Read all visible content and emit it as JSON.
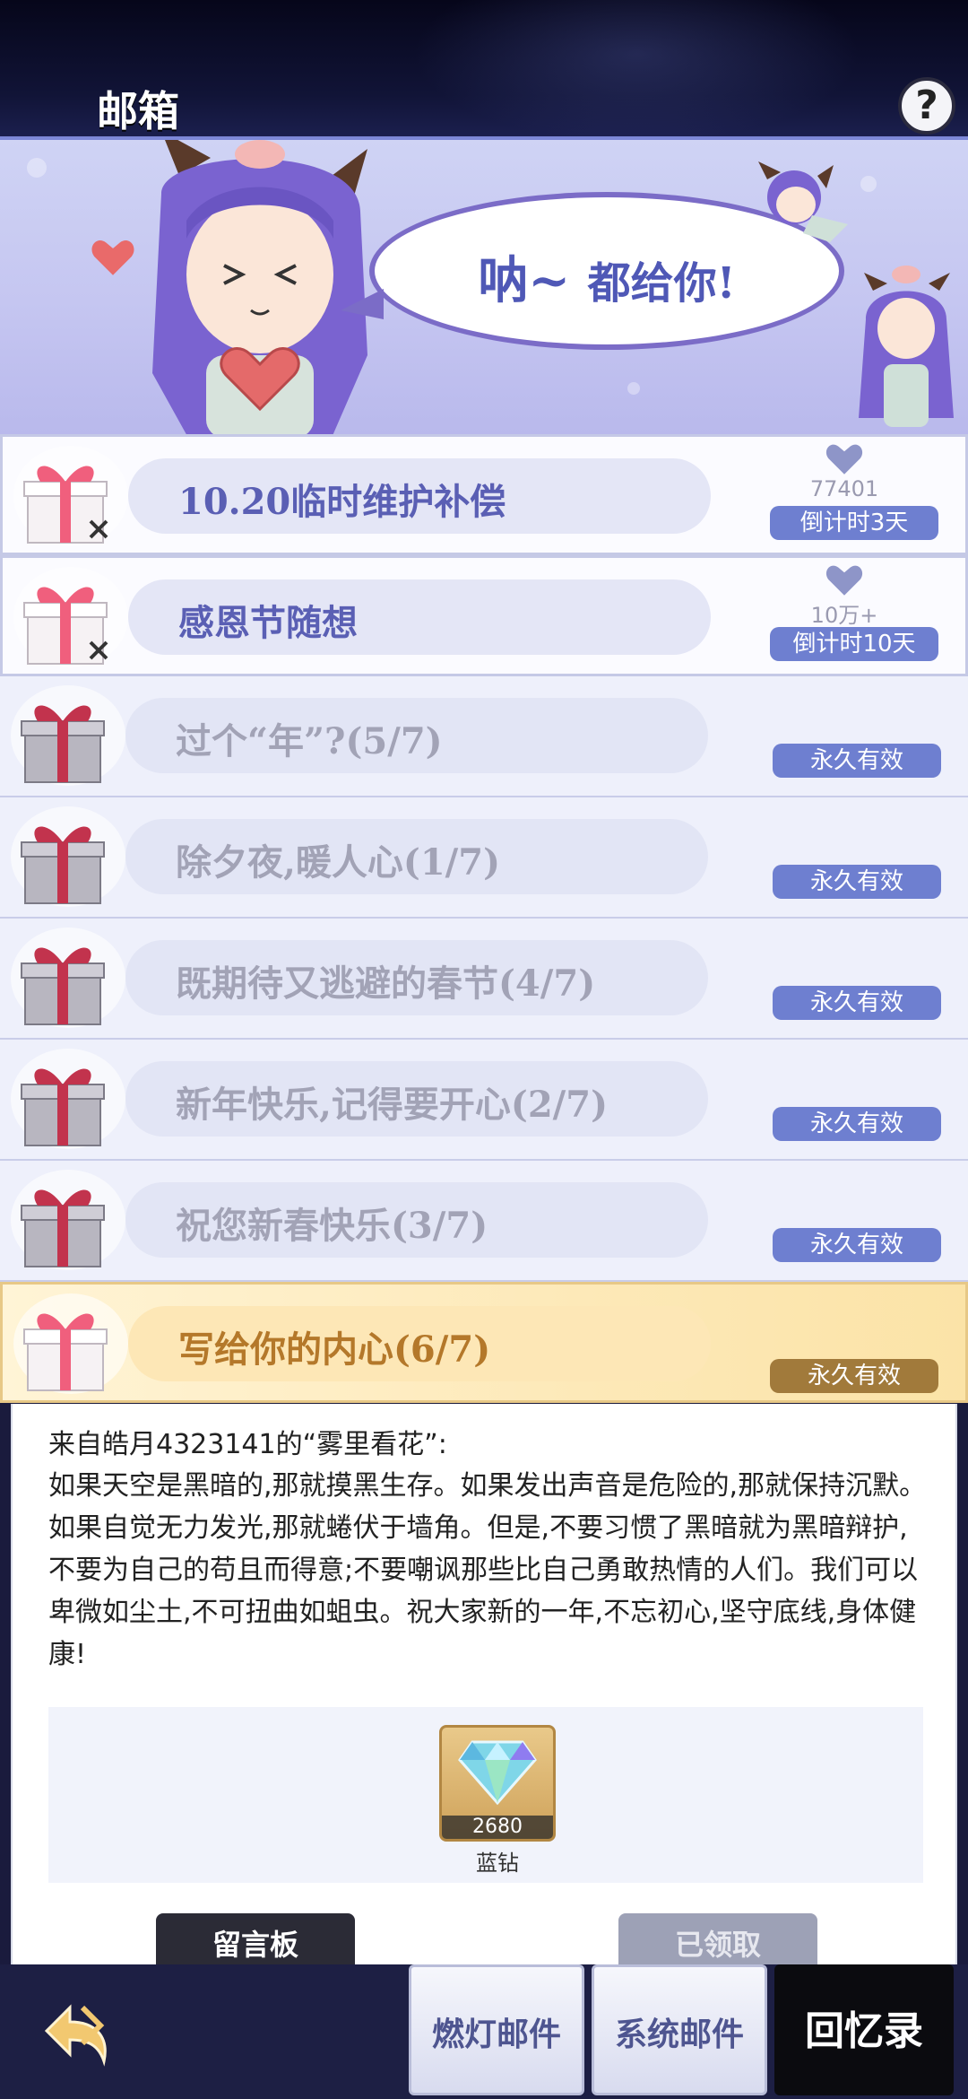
{
  "header": {
    "title": "邮箱",
    "help_label": "?"
  },
  "banner": {
    "bubble_word": "呐~",
    "bubble_rest": "都给你!"
  },
  "mails": [
    {
      "title": "10.20临时维护补偿",
      "status": "倒计时3天",
      "likes": "77401",
      "unread": true
    },
    {
      "title": "感恩节随想",
      "status": "倒计时10天",
      "likes": "10万+",
      "unread": true
    },
    {
      "title": "过个“年”?(5/7)",
      "status": "永久有效"
    },
    {
      "title": "除夕夜,暖人心(1/7)",
      "status": "永久有效"
    },
    {
      "title": "既期待又逃避的春节(4/7)",
      "status": "永久有效"
    },
    {
      "title": "新年快乐,记得要开心(2/7)",
      "status": "永久有效"
    },
    {
      "title": "祝您新春快乐(3/7)",
      "status": "永久有效"
    },
    {
      "title": "写给你的内心(6/7)",
      "status": "永久有效",
      "selected": true
    }
  ],
  "detail": {
    "sender": "来自皓月4323141的“雾里看花”:",
    "body": "如果天空是黑暗的,那就摸黑生存。如果发出声音是危险的,那就保持沉默。如果自觉无力发光,那就蜷伏于墙角。但是,不要习惯了黑暗就为黑暗辩护,不要为自己的苟且而得意;不要嘲讽那些比自己勇敢热情的人们。我们可以卑微如尘土,不可扭曲如蛆虫。祝大家新的一年,不忘初心,坚守底线,身体健康!",
    "attachment": {
      "icon": "blue-diamond-icon",
      "count": "2680",
      "name": "蓝钻"
    },
    "message_board_label": "留言板",
    "claimed_label": "已领取"
  },
  "bottom_nav": {
    "tabs": [
      "燃灯邮件",
      "系统邮件",
      "回忆录"
    ]
  },
  "colors": {
    "accent": "#6e7fd0",
    "selected_badge": "#a17a3b",
    "title_active": "#5a5fb4"
  }
}
